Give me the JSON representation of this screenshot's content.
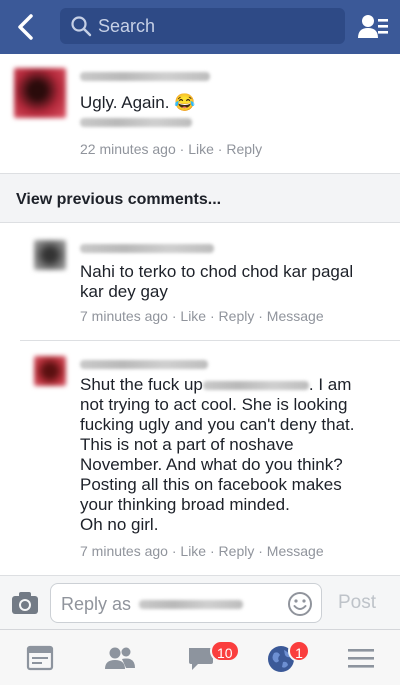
{
  "header": {
    "search_placeholder": "Search"
  },
  "comments": [
    {
      "text": "Ugly. Again.",
      "emoji": "😂",
      "time": "22 minutes ago",
      "actions": [
        "Like",
        "Reply"
      ]
    }
  ],
  "view_previous_label": "View previous comments...",
  "replies": [
    {
      "text": "Nahi to terko to chod chod kar pagal kar dey gay",
      "time": "7 minutes ago",
      "actions": [
        "Like",
        "Reply",
        "Message"
      ]
    },
    {
      "text_lines": [
        "Shut the fuck up",
        ". I am",
        "not trying to act cool. She is looking",
        "fucking ugly and you can't deny that.",
        "This is not a part of noshave",
        "November. And what do you think?",
        "Posting all this on facebook makes",
        "your thinking broad minded.",
        "Oh no girl."
      ],
      "time": "7 minutes ago",
      "actions": [
        "Like",
        "Reply",
        "Message"
      ]
    }
  ],
  "composer": {
    "placeholder": "Reply as",
    "post_label": "Post"
  },
  "tabbar": {
    "messages_badge": "10",
    "notifications_badge": "1"
  },
  "colors": {
    "brand": "#3b5998",
    "badge": "#fa3e3e",
    "meta": "#90949c"
  }
}
